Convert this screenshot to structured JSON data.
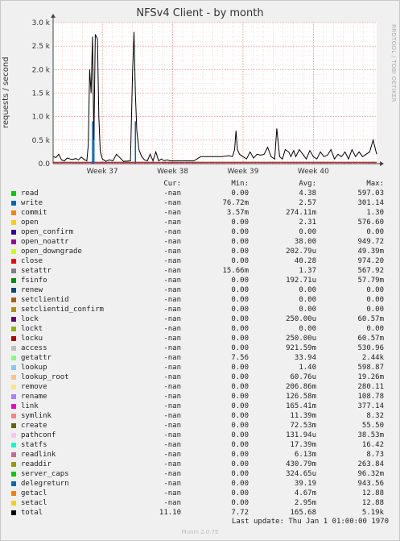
{
  "title": "NFSv4 Client - by month",
  "side_text": "RRDTOOL / TOBI OETIKER",
  "ylabel": "requests / second",
  "legend_headers": {
    "cur": "Cur:",
    "min": "Min:",
    "avg": "Avg:",
    "max": "Max:"
  },
  "rows": [
    {
      "label": "read",
      "color": "#00cc00",
      "cur": "-nan",
      "min": "0.00",
      "avg": "4.38",
      "max": "597.03"
    },
    {
      "label": "write",
      "color": "#0066b3",
      "cur": "-nan",
      "min": "76.72m",
      "avg": "2.57",
      "max": "301.14"
    },
    {
      "label": "commit",
      "color": "#ff8000",
      "cur": "-nan",
      "min": "3.57m",
      "avg": "274.11m",
      "max": "1.30"
    },
    {
      "label": "open",
      "color": "#ffcc00",
      "cur": "-nan",
      "min": "0.00",
      "avg": "2.31",
      "max": "576.60"
    },
    {
      "label": "open_confirm",
      "color": "#330099",
      "cur": "-nan",
      "min": "0.00",
      "avg": "0.00",
      "max": "0.00"
    },
    {
      "label": "open_noattr",
      "color": "#990099",
      "cur": "-nan",
      "min": "0.00",
      "avg": "38.00",
      "max": "949.72"
    },
    {
      "label": "open_downgrade",
      "color": "#ccff00",
      "cur": "-nan",
      "min": "0.00",
      "avg": "202.79u",
      "max": "49.39m"
    },
    {
      "label": "close",
      "color": "#ff0000",
      "cur": "-nan",
      "min": "0.00",
      "avg": "40.28",
      "max": "974.20"
    },
    {
      "label": "setattr",
      "color": "#808080",
      "cur": "-nan",
      "min": "15.66m",
      "avg": "1.37",
      "max": "567.92"
    },
    {
      "label": "fsinfo",
      "color": "#008f00",
      "cur": "-nan",
      "min": "0.00",
      "avg": "192.71u",
      "max": "57.79m"
    },
    {
      "label": "renew",
      "color": "#00487d",
      "cur": "-nan",
      "min": "0.00",
      "avg": "0.00",
      "max": "0.00"
    },
    {
      "label": "setclientid",
      "color": "#b35a00",
      "cur": "-nan",
      "min": "0.00",
      "avg": "0.00",
      "max": "0.00"
    },
    {
      "label": "setclientid_confirm",
      "color": "#b38f00",
      "cur": "-nan",
      "min": "0.00",
      "avg": "0.00",
      "max": "0.00"
    },
    {
      "label": "lock",
      "color": "#6b006b",
      "cur": "-nan",
      "min": "0.00",
      "avg": "250.00u",
      "max": "60.57m"
    },
    {
      "label": "lockt",
      "color": "#8fb300",
      "cur": "-nan",
      "min": "0.00",
      "avg": "0.00",
      "max": "0.00"
    },
    {
      "label": "locku",
      "color": "#b30000",
      "cur": "-nan",
      "min": "0.00",
      "avg": "250.00u",
      "max": "60.57m"
    },
    {
      "label": "access",
      "color": "#bebebe",
      "cur": "-nan",
      "min": "0.00",
      "avg": "921.59m",
      "max": "530.96"
    },
    {
      "label": "getattr",
      "color": "#80ff80",
      "cur": "-nan",
      "min": "7.56",
      "avg": "33.94",
      "max": "2.44k"
    },
    {
      "label": "lookup",
      "color": "#80c9ff",
      "cur": "-nan",
      "min": "0.00",
      "avg": "1.40",
      "max": "598.87"
    },
    {
      "label": "lookup_root",
      "color": "#ffc080",
      "cur": "-nan",
      "min": "0.00",
      "avg": "60.76u",
      "max": "19.26m"
    },
    {
      "label": "remove",
      "color": "#ffe680",
      "cur": "-nan",
      "min": "0.00",
      "avg": "206.86m",
      "max": "280.11"
    },
    {
      "label": "rename",
      "color": "#aa80ff",
      "cur": "-nan",
      "min": "0.00",
      "avg": "126.58m",
      "max": "108.78"
    },
    {
      "label": "link",
      "color": "#ee00cc",
      "cur": "-nan",
      "min": "0.00",
      "avg": "165.41m",
      "max": "377.14"
    },
    {
      "label": "symlink",
      "color": "#ff8080",
      "cur": "-nan",
      "min": "0.00",
      "avg": "11.39m",
      "max": "8.32"
    },
    {
      "label": "create",
      "color": "#666600",
      "cur": "-nan",
      "min": "0.00",
      "avg": "72.53m",
      "max": "55.50"
    },
    {
      "label": "pathconf",
      "color": "#ffbfff",
      "cur": "-nan",
      "min": "0.00",
      "avg": "131.94u",
      "max": "38.53m"
    },
    {
      "label": "statfs",
      "color": "#00ffcc",
      "cur": "-nan",
      "min": "0.00",
      "avg": "17.39m",
      "max": "16.42"
    },
    {
      "label": "readlink",
      "color": "#cc6699",
      "cur": "-nan",
      "min": "0.00",
      "avg": "6.13m",
      "max": "8.73"
    },
    {
      "label": "readdir",
      "color": "#999900",
      "cur": "-nan",
      "min": "0.00",
      "avg": "430.79m",
      "max": "263.84"
    },
    {
      "label": "server_caps",
      "color": "#00cc00",
      "cur": "-nan",
      "min": "0.00",
      "avg": "324.65u",
      "max": "96.32m"
    },
    {
      "label": "delegreturn",
      "color": "#0066b3",
      "cur": "-nan",
      "min": "0.00",
      "avg": "39.19",
      "max": "943.56"
    },
    {
      "label": "getacl",
      "color": "#ff8000",
      "cur": "-nan",
      "min": "0.00",
      "avg": "4.67m",
      "max": "12.88"
    },
    {
      "label": "setacl",
      "color": "#ffcc00",
      "cur": "-nan",
      "min": "0.00",
      "avg": "2.95m",
      "max": "12.88"
    },
    {
      "label": "total",
      "color": "#000000",
      "cur": "11.10",
      "min": "7.72",
      "avg": "165.68",
      "max": "5.19k"
    }
  ],
  "footer": "Last update: Thu Jan  1 01:00:00 1970",
  "munin": "Munin 2.0.75",
  "chart_data": {
    "type": "line",
    "title": "NFSv4 Client - by month",
    "xlabel": "",
    "ylabel": "requests / second",
    "ylim": [
      0,
      3000
    ],
    "y_ticks": [
      0,
      500,
      1000,
      1500,
      2000,
      2500,
      3000
    ],
    "y_tick_labels": [
      "0.0",
      "0.5 k",
      "1.0 k",
      "1.5 k",
      "2.0 k",
      "2.5 k",
      "3.0 k"
    ],
    "x_range_weeks": [
      36.3,
      40.9
    ],
    "x_ticks": [
      37,
      38,
      39,
      40
    ],
    "x_tick_labels": [
      "Week 37",
      "Week 38",
      "Week 39",
      "Week 40"
    ],
    "grid": true,
    "series": [
      {
        "name": "total",
        "color": "#000000",
        "x": [
          36.3,
          36.34,
          36.38,
          36.42,
          36.46,
          36.5,
          36.54,
          36.58,
          36.62,
          36.66,
          36.7,
          36.74,
          36.78,
          36.8,
          36.82,
          36.84,
          36.86,
          36.88,
          36.9,
          36.93,
          36.95,
          36.97,
          37.0,
          37.05,
          37.1,
          37.15,
          37.2,
          37.3,
          37.4,
          37.43,
          37.45,
          37.47,
          37.49,
          37.52,
          37.56,
          37.6,
          37.64,
          37.68,
          37.72,
          37.76,
          37.8,
          37.84,
          37.88,
          37.92,
          37.96,
          38.0,
          38.1,
          38.2,
          38.3,
          38.4,
          38.5,
          38.6,
          38.7,
          38.8,
          38.85,
          38.88,
          38.9,
          38.92,
          38.95,
          39.0,
          39.05,
          39.1,
          39.15,
          39.2,
          39.25,
          39.3,
          39.35,
          39.4,
          39.45,
          39.48,
          39.52,
          39.56,
          39.6,
          39.65,
          39.68,
          39.72,
          39.75,
          39.8,
          39.85,
          39.9,
          39.95,
          40.0,
          40.05,
          40.1,
          40.15,
          40.2,
          40.25,
          40.3,
          40.35,
          40.4,
          40.45,
          40.5,
          40.55,
          40.6,
          40.65,
          40.7,
          40.75,
          40.8,
          40.85,
          40.9
        ],
        "y": [
          150,
          130,
          200,
          80,
          60,
          120,
          100,
          90,
          110,
          80,
          140,
          90,
          60,
          400,
          2000,
          1500,
          2700,
          500,
          2750,
          2650,
          1000,
          250,
          100,
          50,
          80,
          60,
          200,
          50,
          60,
          2000,
          2800,
          1500,
          700,
          300,
          150,
          80,
          60,
          200,
          60,
          250,
          60,
          100,
          60,
          80,
          60,
          60,
          60,
          60,
          60,
          150,
          150,
          150,
          150,
          170,
          150,
          300,
          700,
          300,
          200,
          150,
          100,
          250,
          120,
          200,
          180,
          200,
          350,
          150,
          100,
          750,
          150,
          100,
          300,
          250,
          150,
          280,
          150,
          300,
          200,
          100,
          280,
          150,
          100,
          250,
          150,
          180,
          300,
          100,
          200,
          150,
          250,
          100,
          300,
          150,
          250,
          150,
          200,
          250,
          500,
          200
        ]
      }
    ]
  }
}
